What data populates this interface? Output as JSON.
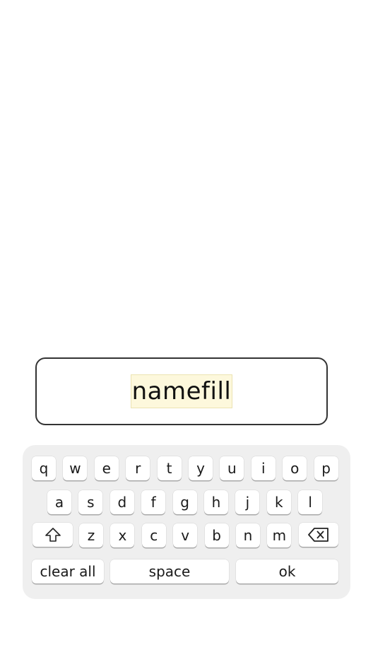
{
  "input": {
    "value": "namefill"
  },
  "keyboard": {
    "row1": [
      "q",
      "w",
      "e",
      "r",
      "t",
      "y",
      "u",
      "i",
      "o",
      "p"
    ],
    "row2": [
      "a",
      "s",
      "d",
      "f",
      "g",
      "h",
      "j",
      "k",
      "l"
    ],
    "row3": [
      "z",
      "x",
      "c",
      "v",
      "b",
      "n",
      "m"
    ],
    "shift_icon": "shift-arrow-icon",
    "backspace_icon": "backspace-icon",
    "clear_label": "clear all",
    "space_label": "space",
    "ok_label": "ok"
  }
}
